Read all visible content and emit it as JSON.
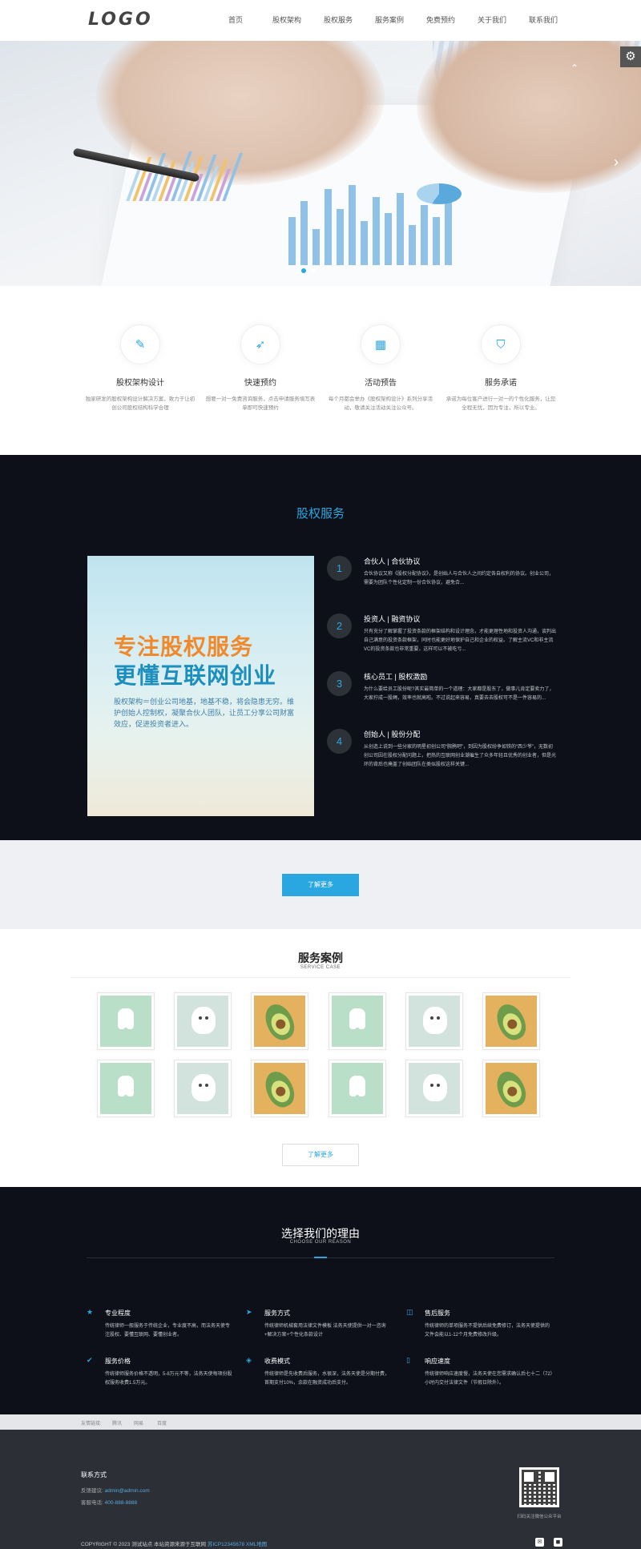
{
  "header": {
    "logo": "LOGO",
    "nav": [
      "首页",
      "股权架构",
      "股权服务",
      "服务案例",
      "免费预约",
      "关于我们",
      "联系我们"
    ]
  },
  "banner": {
    "slide_count": 2,
    "active_slide": 1,
    "colors": {
      "accent": "#2aa7e0"
    }
  },
  "features": [
    {
      "icon": "pencil-icon",
      "title": "股权架构设计",
      "desc": "独家研发的股权架构设计解决方案，致力于让初创公司股权结构科学合理"
    },
    {
      "icon": "rocket-icon",
      "title": "快速预约",
      "desc": "想要一对一免费咨询服务，点击申请服务填写表单即可快速预约"
    },
    {
      "icon": "calendar-icon",
      "title": "活动预告",
      "desc": "每个月都会举办《股权架构设计》系列分享活动，敬请关注活动关注公众号。"
    },
    {
      "icon": "shield-icon",
      "title": "服务承诺",
      "desc": "承诺为每位客户进行一对一的个性化服务，让您全程无忧，因为专注，所以专业。"
    }
  ],
  "equity": {
    "title": "股权服务",
    "promo": {
      "line1": "专注股权服务",
      "line2": "更懂互联网创业",
      "line3": "股权架构＝创业公司地基，地基不稳，将会隐患无穷。维护创始人控制权，凝聚合伙人团队，让员工分享公司财富效应，促进投资者进入。"
    },
    "steps": [
      {
        "num": "1",
        "title": "合伙人 | 合伙协议",
        "desc": "合伙协议又称《股权分配协议》，是创始人与合伙人之间约定各自权利的协议。创业公司，需要为团队个性化定制一份合伙协议，避免合..."
      },
      {
        "num": "2",
        "title": "投资人 | 融资协议",
        "desc": "只有充分了解掌握了投资条款的框架结构和设计理念，才能更理性地和投资人沟通，谈判出自己满意的投资条款框架，同时也能更好地保护自己和企业的权益。了解主流VC和非主流VC的投资条款也非常重要，这样可以不被吃亏..."
      },
      {
        "num": "3",
        "title": "核心员工 | 股权激励",
        "desc": "为什么要给员工股份呢?其实最简单的一个道理：大家都是股东了，做事儿肯定要卖力了，大家拧成一股绳，效率也就高啦。不过说起来容易，真要去去股权可不是一件容易的..."
      },
      {
        "num": "4",
        "title": "创始人 | 股份分配",
        "desc": "从创造上说到一些分家的明星初创公司“腕鹃吧”，到因为股权纷争如铁的“西少爷”，无数初创公司因在股权分配问题上，把热的互联网创业潮催生了众多年轻且优秀的创业者，但是光环的背后也掩盖了创始团队在类似股权这样关键..."
      }
    ]
  },
  "cta": {
    "label": "了解更多"
  },
  "cases": {
    "title": "服务案例",
    "subtitle": "SERVICE CASE",
    "items": [
      "tooth",
      "dog",
      "avocado",
      "tooth",
      "dog",
      "avocado",
      "tooth",
      "dog",
      "avocado",
      "tooth",
      "dog",
      "avocado"
    ],
    "more_label": "了解更多"
  },
  "why": {
    "title": "选择我们的理由",
    "subtitle": "CHOOSE OUR REASON",
    "reasons": [
      {
        "icon": "star-icon",
        "title": "专业程度",
        "desc": "传统律师一般服务于传统企业，专业度不高，而法务天使专注股权、要懂互联网、要懂创业者。"
      },
      {
        "icon": "send-icon",
        "title": "服务方式",
        "desc": "传统律师机械套用法律文件模板 法务天使提供一对一咨询+解决方案+个性化条款设计"
      },
      {
        "icon": "gift-icon",
        "title": "售后服务",
        "desc": "传统律师的单项服务不提供后续免费修订，法务天使提供的文件会能以1-12个月免费修改升级。"
      },
      {
        "icon": "check-icon",
        "title": "服务价格",
        "desc": "传统律师服务价格不透明，5-8万元不等，法务天使每项份股权服务收费1.5万元。"
      },
      {
        "icon": "tag-icon",
        "title": "收费模式",
        "desc": "传统律师是先收费后服务，水很深，法务天使是分期付费，首期支付10%，余款在融资成功后支付。"
      },
      {
        "icon": "phone-icon",
        "title": "响应速度",
        "desc": "传统律师响应速度慢，法务天使在您需求确认后七十二（72）小时内交付法律文件（节假日除外）。"
      }
    ]
  },
  "links": {
    "label": "友情链接:",
    "items": [
      "腾讯",
      "网易",
      "百度"
    ]
  },
  "footer": {
    "contact_title": "联系方式",
    "email_label": "反馈建议:",
    "email": "admin@admin.com",
    "phone_label": "客服电话:",
    "phone": "400-888-8888",
    "qr_caption": "扫码关注微信公众平台",
    "copyright": "COPYRIGHT © 2023 测试站点 本站资源来源于互联网",
    "icp": "苏ICP12345678",
    "sitemap": "XML地图"
  }
}
